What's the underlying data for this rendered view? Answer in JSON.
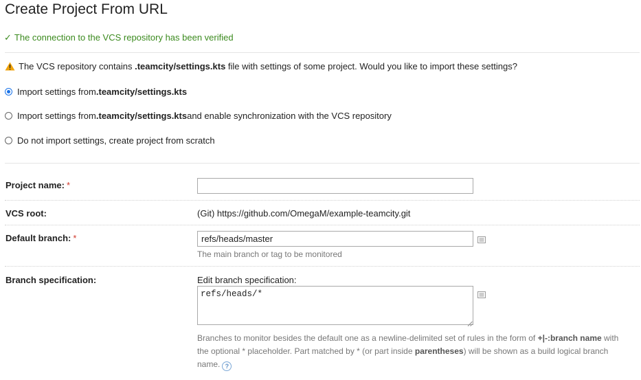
{
  "page": {
    "title": "Create Project From URL"
  },
  "verification": {
    "message": "The connection to the VCS repository has been verified"
  },
  "warning": {
    "prefix": "The VCS repository contains ",
    "file": ".teamcity/settings.kts",
    "suffix": " file with settings of some project. Would you like to import these settings?"
  },
  "import_options": [
    {
      "prefix": "Import settings from ",
      "file": ".teamcity/settings.kts",
      "suffix": "",
      "checked": true
    },
    {
      "prefix": "Import settings from ",
      "file": ".teamcity/settings.kts",
      "suffix": " and enable synchronization with the VCS repository",
      "checked": false
    },
    {
      "prefix": "Do not import settings, create project from scratch",
      "file": "",
      "suffix": "",
      "checked": false
    }
  ],
  "form": {
    "project_name": {
      "label": "Project name:",
      "required_mark": "*",
      "value": ""
    },
    "vcs_root": {
      "label": "VCS root:",
      "value": "(Git) https://github.com/OmegaM/example-teamcity.git"
    },
    "default_branch": {
      "label": "Default branch:",
      "required_mark": "*",
      "value": "refs/heads/master",
      "hint": "The main branch or tag to be monitored"
    },
    "branch_spec": {
      "label": "Branch specification:",
      "edit_label": "Edit branch specification:",
      "value": "refs/heads/*",
      "help": {
        "part1": "Branches to monitor besides the default one as a newline-delimited set of rules in the form of ",
        "syntax": "+|-:branch name",
        "part2": " with the optional * placeholder. Part matched by * (or part inside ",
        "parens": "parentheses",
        "part3": ") will be shown as a build logical branch name.",
        "icon": "?"
      }
    }
  },
  "colors": {
    "success": "#3b8a1e",
    "warning": "#f0a30a",
    "radio_selected": "#1a73e8",
    "required": "#d0372b"
  }
}
